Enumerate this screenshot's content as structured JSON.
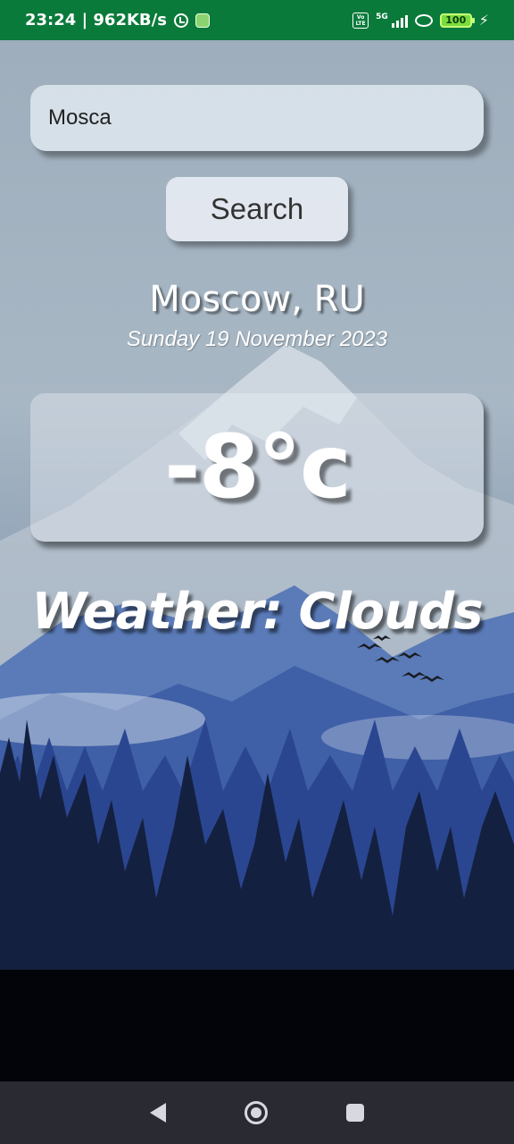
{
  "status_bar": {
    "time_speed": "23:24 | 962KB/s",
    "network": "5G",
    "volte": "Vo LTE",
    "battery": "100"
  },
  "search": {
    "value": "Mosca",
    "button_label": "Search"
  },
  "location": {
    "city": "Moscow, RU",
    "date": "Sunday 19 November 2023"
  },
  "weather": {
    "temperature": "-8°c",
    "condition": "Weather: Clouds"
  },
  "colors": {
    "status_bar": "#0a7a3a",
    "nav_bar": "#2a2a32"
  },
  "nav": {
    "icons": [
      "back-icon",
      "home-icon",
      "recents-icon"
    ]
  }
}
